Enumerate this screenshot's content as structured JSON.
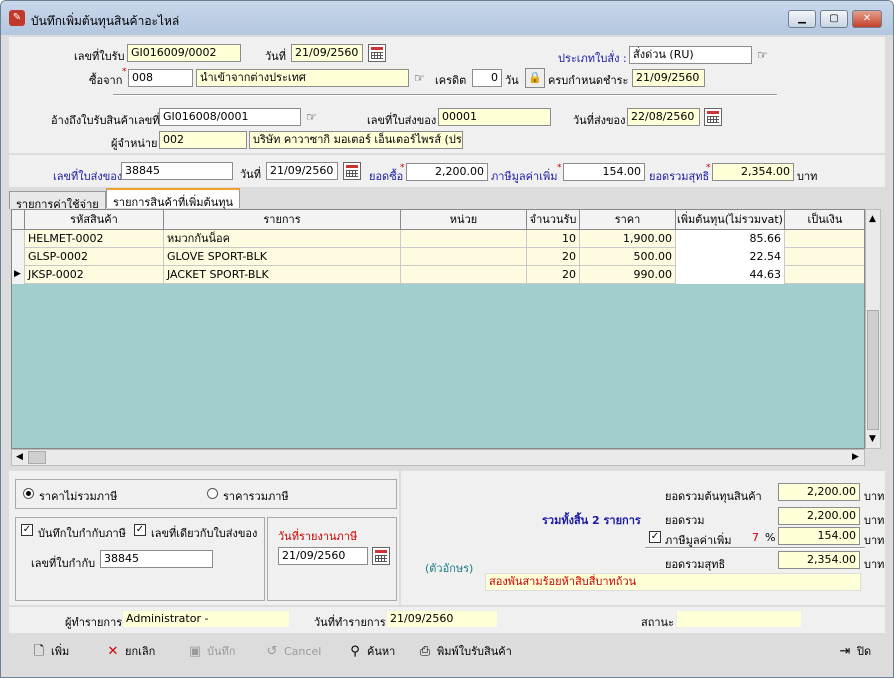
{
  "window": {
    "title": "บันทึกเพิ่มต้นทุนสินค้าอะไหล่"
  },
  "header": {
    "receipt_no_label": "เลขที่ใบรับ",
    "receipt_no": "GI016009/0002",
    "date_label": "วันที่",
    "date": "21/09/2560",
    "purchase_type_label": "ประเภทใบสั่ง :",
    "purchase_type": "สั่งด่วน (RU)",
    "buy_from_label": "ซื้อจาก",
    "supplier_code": "008",
    "supplier_name": "นำเข้าจากต่างประเทศ",
    "credit_label": "เครดิต",
    "credit_days": "0",
    "days_unit": "วัน",
    "due_label": "ครบกำหนดชำระ",
    "due_date": "21/09/2560",
    "ref_receipt_label": "อ้างถึงใบรับสินค้าเลขที่",
    "ref_receipt_no": "GI016008/0001",
    "delivery_no_label": "เลขที่ใบส่งของ",
    "delivery_no": "00001",
    "delivery_date_label": "วันที่ส่งของ",
    "delivery_date": "22/08/2560",
    "distributor_label": "ผู้จำหน่าย",
    "distributor_code": "002",
    "distributor_name": "บริษัท คาวาซากิ มอเตอร์ เอ็นเตอร์ไพรส์ (ประ"
  },
  "summary_bar": {
    "delivery_no_label": "เลขที่ใบส่งของ",
    "delivery_no": "38845",
    "date_label": "วันที่",
    "date": "21/09/2560",
    "purchase_total_label": "ยอดซื้อ",
    "purchase_total": "2,200.00",
    "vat_label": "ภาษีมูลค่าเพิ่ม",
    "vat": "154.00",
    "net_label": "ยอดรวมสุทธิ",
    "net": "2,354.00",
    "currency": "บาท"
  },
  "tabs": [
    {
      "label": "รายการค่าใช้จ่าย",
      "active": false
    },
    {
      "label": "รายการสินค้าที่เพิ่มต้นทุน",
      "active": true
    }
  ],
  "grid": {
    "columns": [
      "รหัสสินค้า",
      "รายการ",
      "หน่วย",
      "จำนวนรับ",
      "ราคา",
      "เพิ่มต้นทุน(ไม่รวมvat)",
      "เป็นเงิน"
    ],
    "rows": [
      {
        "code": "HELMET-0002",
        "name": "หมวกกันน็อค",
        "unit": "",
        "qty": "10",
        "price": "1,900.00",
        "add_cost": "85.66",
        "amount": ""
      },
      {
        "code": "GLSP-0002",
        "name": "GLOVE SPORT-BLK",
        "unit": "",
        "qty": "20",
        "price": "500.00",
        "add_cost": "22.54",
        "amount": ""
      },
      {
        "code": "JKSP-0002",
        "name": "JACKET SPORT-BLK",
        "unit": "",
        "qty": "20",
        "price": "990.00",
        "add_cost": "44.63",
        "amount": ""
      }
    ]
  },
  "options": {
    "price_excl_vat": "ราคาไม่รวมภาษี",
    "price_incl_vat": "ราคารวมภาษี",
    "record_tax_invoice": "บันทึกใบกำกับภาษี",
    "same_as_delivery": "เลขที่เดียวกับใบส่งของ",
    "tax_invoice_no_label": "เลขที่ใบกำกับ",
    "tax_invoice_no": "38845",
    "tax_report_date_label": "วันที่รายงานภาษี",
    "tax_report_date": "21/09/2560"
  },
  "totals": {
    "cost_total_label": "ยอดรวมต้นทุนสินค้า",
    "cost_total": "2,200.00",
    "item_count_text": "รวมทั้งสิ้น 2 รายการ",
    "subtotal_label": "ยอดรวม",
    "subtotal": "2,200.00",
    "vat_label": "ภาษีมูลค่าเพิ่ม",
    "vat_rate": "7",
    "percent": "%",
    "vat": "154.00",
    "net_label": "ยอดรวมสุทธิ",
    "net": "2,354.00",
    "currency": "บาท",
    "in_words_label": "(ตัวอักษร)",
    "in_words": "สองพันสามร้อยห้าสิบสี่บาทถ้วน"
  },
  "footer": {
    "operator_label": "ผู้ทำรายการ",
    "operator": "Administrator -",
    "op_date_label": "วันที่ทำรายการ",
    "op_date": "21/09/2560",
    "status_label": "สถานะ",
    "status": ""
  },
  "toolbar": {
    "add": "เพิ่ม",
    "cancel_doc": "ยกเลิก",
    "save": "บันทึก",
    "cancel": "Cancel",
    "search": "ค้นหา",
    "print": "พิมพ์ใบรับสินค้า",
    "close": "ปิด"
  }
}
